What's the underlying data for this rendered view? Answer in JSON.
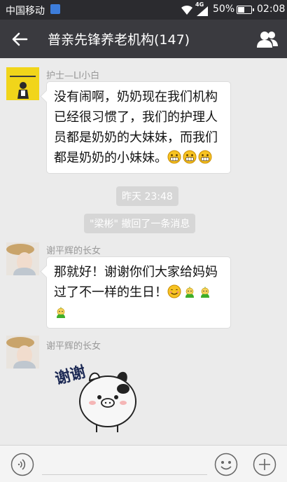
{
  "status_bar": {
    "carrier": "中国移动",
    "network": "4G",
    "battery_pct": "50%",
    "battery_level": 0.5,
    "time": "02:08"
  },
  "header": {
    "title": "普亲先锋养老机构(147)",
    "back_icon": "arrow-left-icon",
    "group_icon": "group-members-icon"
  },
  "messages": [
    {
      "sender": "护士—LI小白",
      "lines": [
        "没有闹啊，奶奶现在我们机构",
        "已经很习惯了，我们的护理人",
        "员都是奶奶的大妹妹，而我们",
        "都是奶奶的小妹妹。"
      ]
    },
    {
      "sender": "谢平辉的长女",
      "lines": [
        "那就好！谢谢你们大家给妈妈",
        "过了不一样的生日！"
      ]
    },
    {
      "sender": "谢平辉的长女",
      "sticker_text": "谢谢"
    }
  ],
  "system": {
    "time": "昨天 23:48",
    "recall": "\"梁彬\" 撤回了一条消息"
  },
  "bottom_bar": {
    "voice_icon": "voice-icon",
    "emoji_icon": "emoji-icon",
    "plus_icon": "plus-icon"
  },
  "colors": {
    "status_bar": "#2b2b2f",
    "title_bar": "#3a3a3f",
    "chat_bg": "#ebebeb",
    "bubble": "#ffffff",
    "system_pill": "#d6d6d6"
  }
}
